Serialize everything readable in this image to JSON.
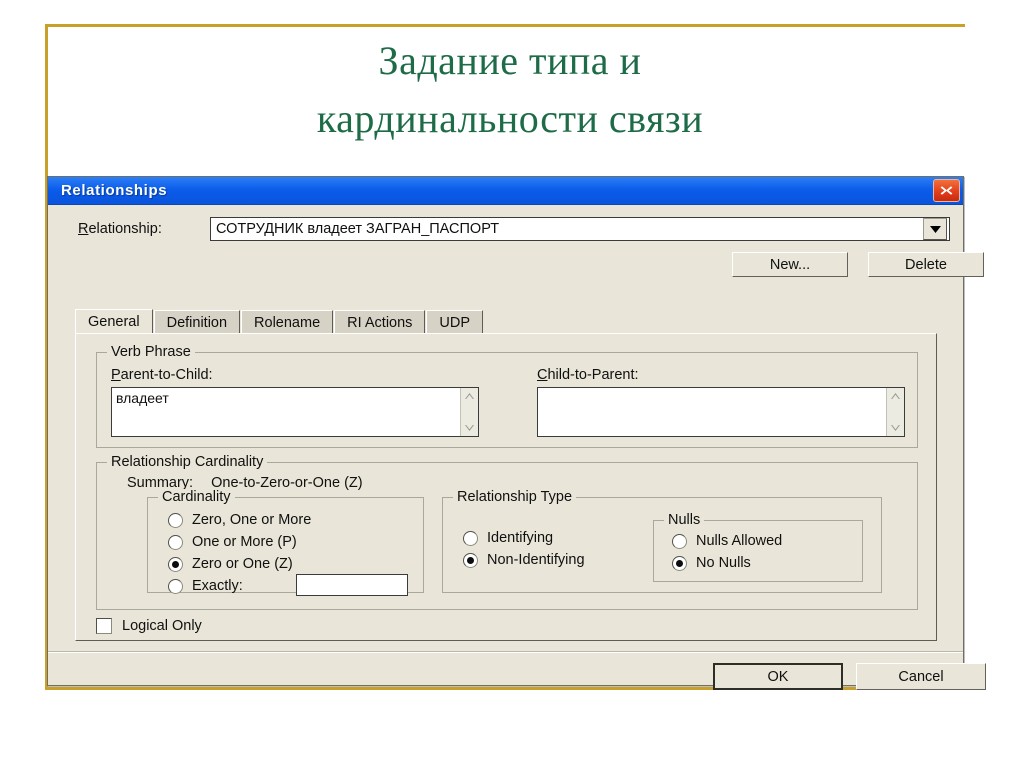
{
  "slide": {
    "title_line1": "Задание типа и",
    "title_line2": "кардинальности связи",
    "title_color": "#1e6b47",
    "frame_color": "#c9a02a"
  },
  "dialog": {
    "title": "Relationships",
    "close_icon": "close-icon",
    "background_color": "#e9e6d9",
    "titlebar_color": "#0a5cea",
    "relationship": {
      "label": "Relationship:",
      "label_accel": "R",
      "value": "СОТРУДНИК владеет ЗАГРАН_ПАСПОРТ",
      "dropdown_icon": "chevron-down-icon"
    },
    "buttons": {
      "new": "New...",
      "delete": "Delete",
      "ok": "OK",
      "cancel": "Cancel"
    },
    "tabs": [
      {
        "label": "General",
        "active": true
      },
      {
        "label": "Definition",
        "active": false
      },
      {
        "label": "Rolename",
        "active": false
      },
      {
        "label": "RI Actions",
        "active": false
      },
      {
        "label": "UDP",
        "active": false
      }
    ],
    "verb_phrase": {
      "group_title": "Verb Phrase",
      "parent_to_child_label": "Parent-to-Child:",
      "parent_to_child_accel": "P",
      "parent_to_child_value": "владеет",
      "child_to_parent_label": "Child-to-Parent:",
      "child_to_parent_accel": "C",
      "child_to_parent_value": "",
      "scroll_up_icon": "chevron-up-icon",
      "scroll_down_icon": "chevron-down-icon"
    },
    "cardinality_section": {
      "group_title": "Relationship Cardinality",
      "summary_label": "Summary:",
      "summary_value": "One-to-Zero-or-One (Z)",
      "cardinality": {
        "group_title": "Cardinality",
        "options": [
          {
            "label": "Zero, One or More",
            "selected": false
          },
          {
            "label": "One or More (P)",
            "selected": false
          },
          {
            "label": "Zero or One (Z)",
            "selected": true
          },
          {
            "label": "Exactly:",
            "selected": false
          }
        ],
        "exactly_value": ""
      },
      "relationship_type": {
        "group_title": "Relationship Type",
        "options": [
          {
            "label": "Identifying",
            "selected": false
          },
          {
            "label": "Non-Identifying",
            "selected": true
          }
        ]
      },
      "nulls": {
        "group_title": "Nulls",
        "options": [
          {
            "label": "Nulls Allowed",
            "selected": false
          },
          {
            "label": "No Nulls",
            "selected": true
          }
        ]
      }
    },
    "logical_only": {
      "label": "Logical Only",
      "checked": false
    }
  }
}
